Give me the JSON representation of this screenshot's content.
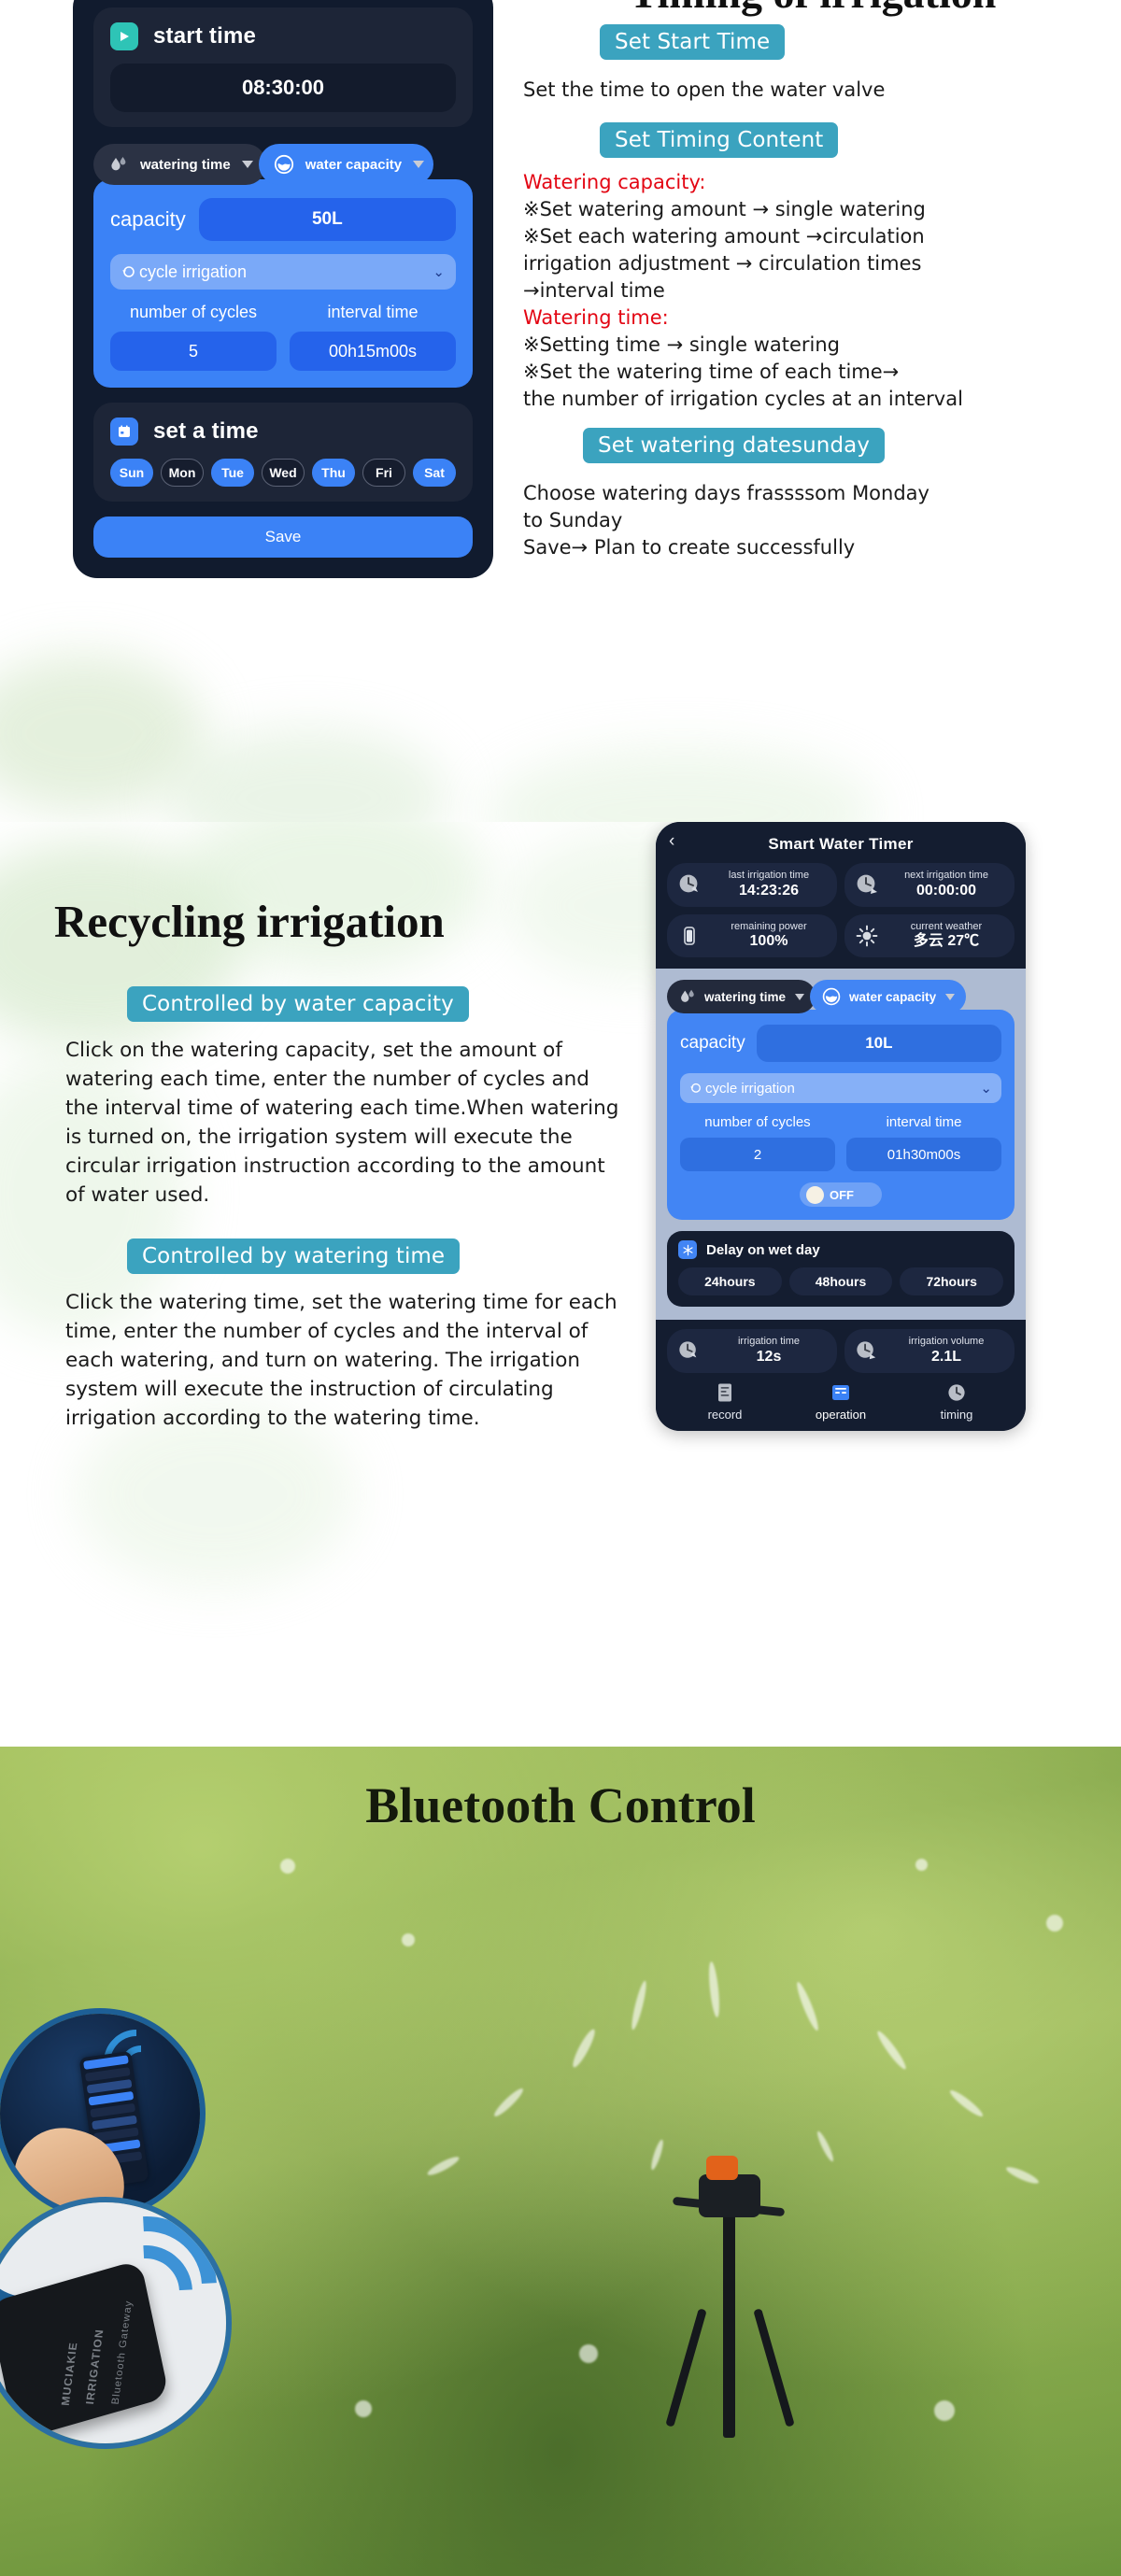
{
  "section_timing": {
    "heading": "Timing of irrigation",
    "phone": {
      "start_time_label": "start time",
      "start_time_value": "08:30:00",
      "start_time_icon": "play-icon",
      "tabs": [
        {
          "label": "watering time",
          "icon": "water-drops-icon",
          "active": false
        },
        {
          "label": "water capacity",
          "icon": "water-bowl-icon",
          "active": true
        }
      ],
      "capacity_label": "capacity",
      "capacity_value": "50L",
      "mode_label": "cycle irrigation",
      "mode_icon": "cycle-icon",
      "cycles_label": "number of cycles",
      "cycles_value": "5",
      "interval_label": "interval time",
      "interval_value": "00h15m00s",
      "set_time_label": "set a time",
      "set_time_icon": "calendar-icon",
      "days": [
        {
          "label": "Sun",
          "on": true
        },
        {
          "label": "Mon",
          "on": false
        },
        {
          "label": "Tue",
          "on": true
        },
        {
          "label": "Wed",
          "on": false
        },
        {
          "label": "Thu",
          "on": true
        },
        {
          "label": "Fri",
          "on": false
        },
        {
          "label": "Sat",
          "on": true
        }
      ],
      "save_label": "Save"
    },
    "chip_start_time": "Set Start Time",
    "p_start_time": "Set the time to open the water valve",
    "chip_timing_content": "Set Timing Content",
    "red_watering_capacity": "Watering capacity:",
    "cap_line1": "※Set watering amount → single watering",
    "cap_line2": "※Set each watering amount →circulation",
    "cap_line3": " irrigation adjustment → circulation times",
    "cap_line4": "→interval time",
    "red_watering_time": "Watering time:",
    "time_line1": "※Setting time → single watering",
    "time_line2": "※Set the watering time of each time→",
    "time_line3": "the number of irrigation cycles at an interval",
    "chip_watering_dates": "Set watering datesunday",
    "p_choose1": "Choose watering days frassssom Monday",
    "p_choose2": "to Sunday",
    "p_save": "Save→ Plan to create successfully"
  },
  "section_recycle": {
    "heading": "Recycling irrigation",
    "chip_capacity": "Controlled by water capacity",
    "p_capacity": "Click on the watering capacity, set the amount of watering each time, enter the number of cycles and the interval time of watering each time.When watering is turned on, the irrigation system will execute the circular irrigation instruction according to the amount of water used.",
    "chip_time": "Controlled by watering time",
    "p_time": "Click the watering time, set the watering time for each time, enter the number of cycles and the interval of each watering, and turn on watering. The irrigation system will execute the instruction of circulating irrigation according to the watering time.",
    "phone": {
      "title": "Smart  Water Timer",
      "back_icon": "back-chevron-icon",
      "stats": [
        {
          "icon": "clock-back-icon",
          "key": "last irrigation time",
          "value": "14:23:26"
        },
        {
          "icon": "clock-next-icon",
          "key": "next irrigation time",
          "value": "00:00:00"
        },
        {
          "icon": "battery-icon",
          "key": "remaining power",
          "value": "100%"
        },
        {
          "icon": "sun-icon",
          "key": "current weather",
          "value": "多云 27℃"
        }
      ],
      "tabs": [
        {
          "label": "watering time",
          "icon": "water-drops-icon",
          "active": false
        },
        {
          "label": "water capacity",
          "icon": "water-bowl-icon",
          "active": true
        }
      ],
      "capacity_label": "capacity",
      "capacity_value": "10L",
      "mode_label": "cycle irrigation",
      "cycles_label": "number of cycles",
      "cycles_value": "2",
      "interval_label": "interval time",
      "interval_value": "01h30m00s",
      "toggle_label": "OFF",
      "wet_day_label": "Delay on wet day",
      "wet_day_icon": "snowflake-icon",
      "wet_day_options": [
        "24hours",
        "48hours",
        "72hours"
      ],
      "footer_stats": [
        {
          "icon": "clock-back-icon",
          "key": "irrigation time",
          "value": "12s"
        },
        {
          "icon": "clock-next-icon",
          "key": "irrigation volume",
          "value": "2.1L"
        }
      ],
      "nav": [
        {
          "icon": "record-icon",
          "label": "record",
          "active": false
        },
        {
          "icon": "operation-icon",
          "label": "operation",
          "active": true
        },
        {
          "icon": "clock-icon",
          "label": "timing",
          "active": false
        }
      ]
    }
  },
  "section_bluetooth": {
    "heading": "Bluetooth Control",
    "gateway_line1": "MUCIAKIE",
    "gateway_line2": "IRRIGATION",
    "gateway_line3": "Bluetooth Gateway"
  },
  "colors": {
    "chip_teal": "#3ba3bf",
    "accent_blue": "#3b82f6",
    "panel_dark": "#111b2e",
    "red": "#e30613"
  }
}
